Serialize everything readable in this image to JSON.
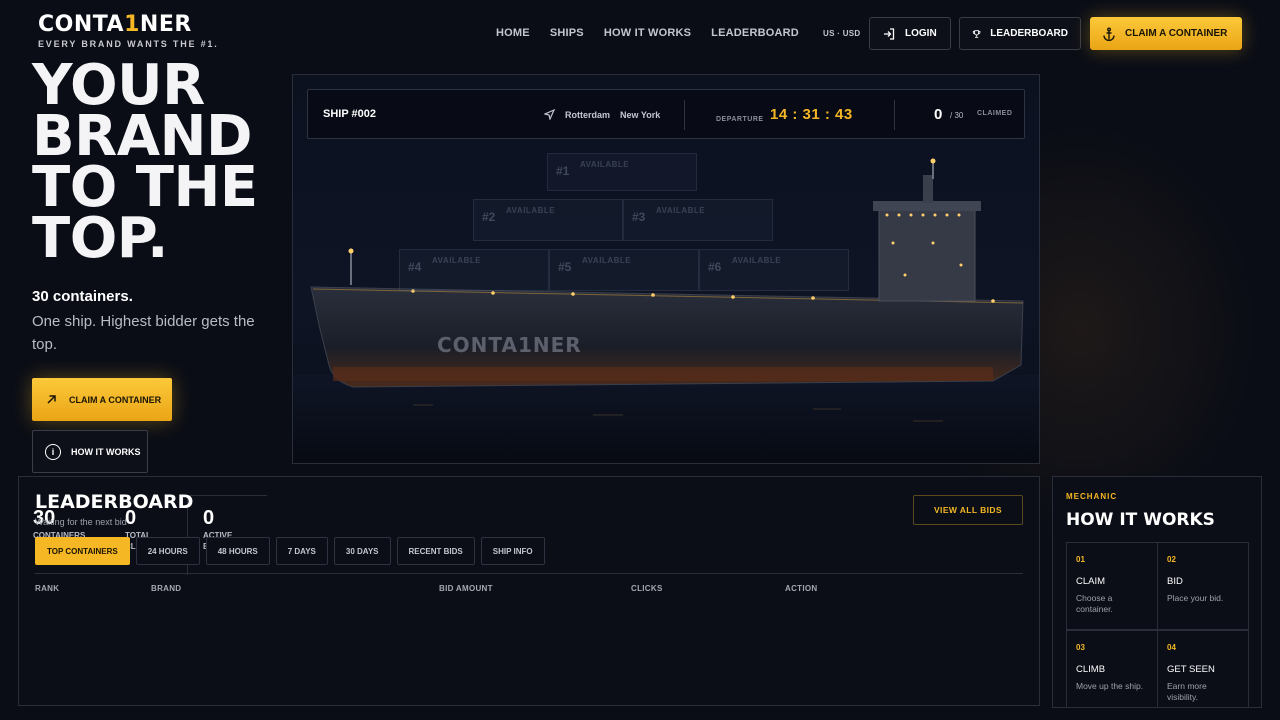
{
  "brand": {
    "logo_pre": "CONTA",
    "logo_one": "1",
    "logo_post": "NER",
    "tagline": "EVERY BRAND WANTS THE #1."
  },
  "nav": {
    "items": [
      "HOME",
      "SHIPS",
      "HOW IT WORKS",
      "LEADERBOARD"
    ]
  },
  "header": {
    "locale": "US · USD",
    "login_label": "LOGIN",
    "leaderboard_label": "LEADERBOARD",
    "claim_label": "CLAIM A CONTAINER"
  },
  "hero": {
    "title": "YOUR\nBRAND\nTO THE\nTOP.",
    "sub_bold": "30 containers.",
    "sub_text": "One ship. Highest bidder gets the top.",
    "cta_claim": "CLAIM A CONTAINER",
    "cta_how": "HOW IT WORKS"
  },
  "ship": {
    "id": "SHIP #002",
    "from": "Rotterdam",
    "to": "New York",
    "departure_label": "DEPARTURE",
    "timer": "14 : 31 : 43",
    "claimed": "0",
    "total": "/ 30",
    "claimed_label": "CLAIMED",
    "hull_brand": "CONTA1NER",
    "slots": [
      {
        "num": "#1",
        "label": "AVAILABLE"
      },
      {
        "num": "#2",
        "label": "AVAILABLE"
      },
      {
        "num": "#3",
        "label": "AVAILABLE"
      },
      {
        "num": "#4",
        "label": "AVAILABLE"
      },
      {
        "num": "#5",
        "label": "AVAILABLE"
      },
      {
        "num": "#6",
        "label": "AVAILABLE"
      }
    ]
  },
  "leaderboard": {
    "title": "LEADERBOARD",
    "subtitle": "Waiting for the next bid",
    "stats": [
      {
        "value": "30",
        "label": "CONTAINERS"
      },
      {
        "value": "0",
        "label": "TOTAL CLICKS"
      },
      {
        "value": "0",
        "label": "ACTIVE BRANDS"
      }
    ],
    "view_all": "VIEW ALL BIDS",
    "tabs": [
      "TOP CONTAINERS",
      "24 HOURS",
      "48 HOURS",
      "7 DAYS",
      "30 DAYS",
      "RECENT BIDS",
      "SHIP INFO"
    ],
    "columns": [
      "RANK",
      "BRAND",
      "BID AMOUNT",
      "CLICKS",
      "ACTION"
    ]
  },
  "how": {
    "kicker": "MECHANIC",
    "title": "HOW IT WORKS",
    "steps": [
      {
        "n": "01",
        "title": "CLAIM",
        "desc": "Choose a container."
      },
      {
        "n": "02",
        "title": "BID",
        "desc": "Place your bid."
      },
      {
        "n": "03",
        "title": "CLIMB",
        "desc": "Move up the ship."
      },
      {
        "n": "04",
        "title": "GET SEEN",
        "desc": "Earn more visibility."
      }
    ]
  },
  "colors": {
    "accent": "#f5b723",
    "background": "#0a0d16",
    "panel_border": "#2a2e3a"
  }
}
